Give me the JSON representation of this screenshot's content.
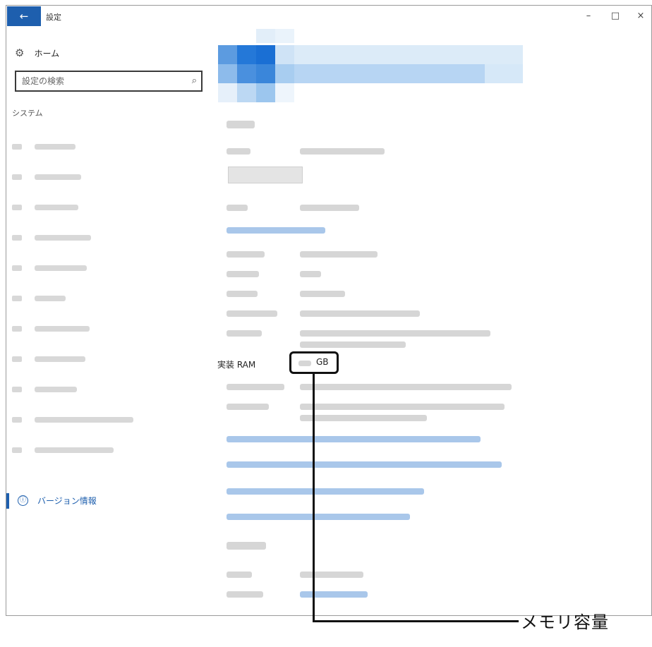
{
  "window": {
    "title": "設定",
    "back_icon": "←",
    "minimize_icon": "–",
    "maximize_icon": "□",
    "close_icon": "×"
  },
  "sidebar": {
    "home_label": "ホーム",
    "search_placeholder": "設定の検索",
    "search_icon": "⌕",
    "section_label": "システム",
    "active_item_label": "バージョン情報",
    "active_item_icon": "ⓘ"
  },
  "main": {
    "ram_label": "実装 RAM",
    "ram_unit": "GB"
  },
  "callout": {
    "label": "メモリ容量"
  },
  "colors": {
    "accent": "#1e5fae",
    "link_blur": "#a9c7ea",
    "blur_gray": "#d6d6d6"
  }
}
